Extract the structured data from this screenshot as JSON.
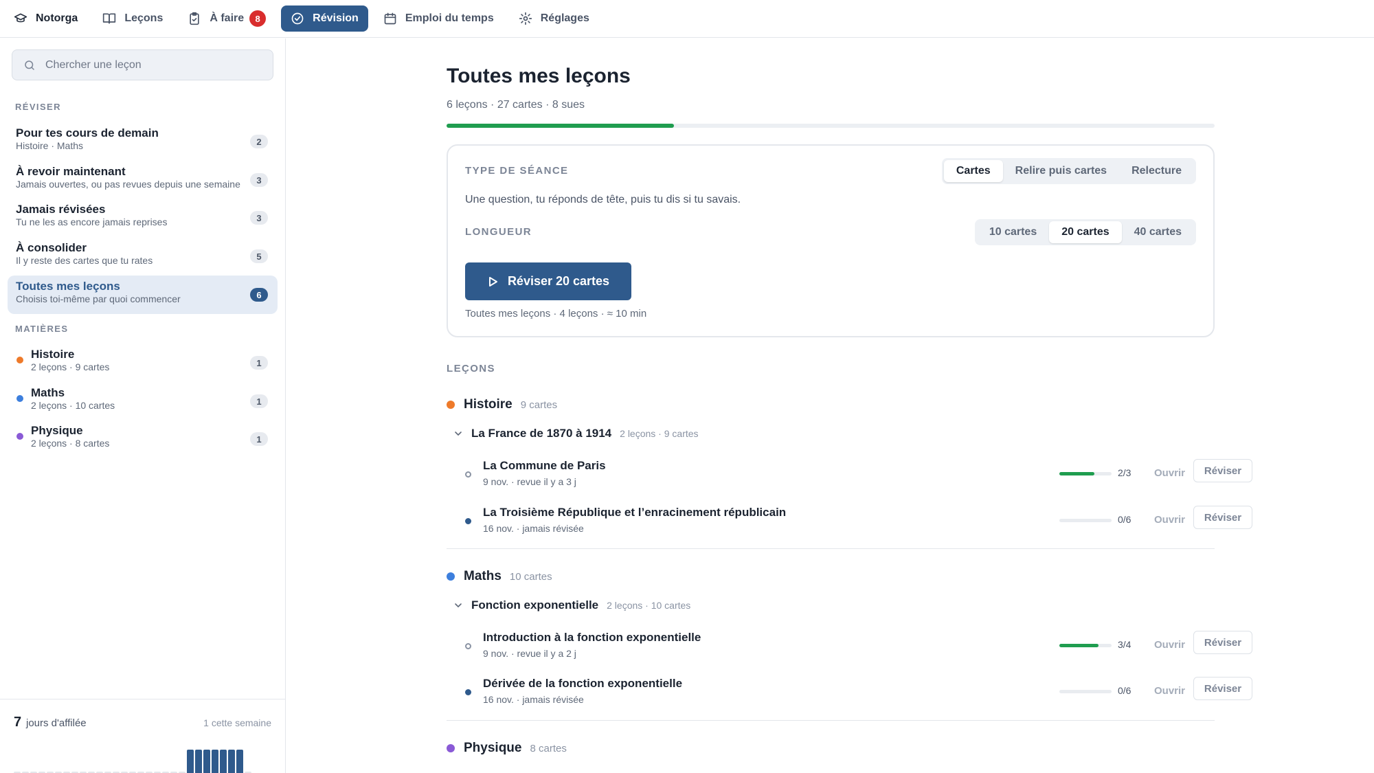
{
  "topbar": {
    "brand": "Notorga",
    "items": [
      {
        "label": "Leçons",
        "icon": "book-icon"
      },
      {
        "label": "À faire",
        "icon": "clipboard-icon",
        "badge": "8"
      },
      {
        "label": "Révision",
        "icon": "check-circle-icon",
        "active": true
      },
      {
        "label": "Emploi du temps",
        "icon": "calendar-icon"
      },
      {
        "label": "Réglages",
        "icon": "gear-icon"
      }
    ]
  },
  "sidebar": {
    "search_placeholder": "Chercher une leçon",
    "review_heading": "RÉVISER",
    "review_items": [
      {
        "title": "Pour tes cours de demain",
        "subtitle": "Histoire · Maths",
        "count": "2"
      },
      {
        "title": "À revoir maintenant",
        "subtitle": "Jamais ouvertes, ou pas revues depuis une semaine",
        "count": "3"
      },
      {
        "title": "Jamais révisées",
        "subtitle": "Tu ne les as encore jamais reprises",
        "count": "3"
      },
      {
        "title": "À consolider",
        "subtitle": "Il y reste des cartes que tu rates",
        "count": "5"
      },
      {
        "title": "Toutes mes leçons",
        "subtitle": "Choisis toi-même par quoi commencer",
        "count": "6",
        "active": true
      }
    ],
    "subjects_heading": "MATIÈRES",
    "subjects": [
      {
        "name": "Histoire",
        "meta": "2 leçons · 9 cartes",
        "count": "1",
        "color": "#ee7a2a"
      },
      {
        "name": "Maths",
        "meta": "2 leçons · 10 cartes",
        "count": "1",
        "color": "#3d7fdd"
      },
      {
        "name": "Physique",
        "meta": "2 leçons · 8 cartes",
        "count": "1",
        "color": "#8a5ad6"
      }
    ],
    "streak": {
      "days": "7",
      "label": "jours d'affilée",
      "week": "1 cette semaine",
      "activity": [
        0,
        0,
        0,
        0,
        0,
        0,
        0,
        0,
        0,
        0,
        0,
        0,
        0,
        0,
        0,
        0,
        0,
        0,
        0,
        0,
        0,
        1,
        1,
        1,
        1,
        1,
        1,
        1,
        0
      ]
    }
  },
  "main": {
    "title": "Toutes mes leçons",
    "meta": "6 leçons · 27 cartes · 8 sues",
    "progress": 0.296,
    "session": {
      "type_label": "TYPE DE SÉANCE",
      "type_options": [
        "Cartes",
        "Relire puis cartes",
        "Relecture"
      ],
      "type_selected": 0,
      "description": "Une question, tu réponds de tête, puis tu dis si tu savais.",
      "length_label": "LONGUEUR",
      "length_options": [
        "10 cartes",
        "20 cartes",
        "40 cartes"
      ],
      "length_selected": 1,
      "start_button": "Réviser 20 cartes",
      "footer": "Toutes mes leçons · 4 leçons · ≈ 10 min"
    },
    "lessons_label": "LEÇONS",
    "subjects": [
      {
        "name": "Histoire",
        "meta": "9 cartes",
        "color": "#ee7a2a",
        "chapter": {
          "name": "La France de 1870 à 1914",
          "meta": "2 leçons · 9 cartes"
        },
        "lessons": [
          {
            "name": "La Commune de Paris",
            "meta": "9 nov. · revue il y a 3 j",
            "score": "2/3",
            "progress": 0.667,
            "state": "open"
          },
          {
            "name": "La Troisième République et l’enracinement républicain",
            "meta": "16 nov. · jamais révisée",
            "score": "0/6",
            "progress": 0,
            "state": "new"
          }
        ]
      },
      {
        "name": "Maths",
        "meta": "10 cartes",
        "color": "#3d7fdd",
        "chapter": {
          "name": "Fonction exponentielle",
          "meta": "2 leçons · 10 cartes"
        },
        "lessons": [
          {
            "name": "Introduction à la fonction exponentielle",
            "meta": "9 nov. · revue il y a 2 j",
            "score": "3/4",
            "progress": 0.75,
            "state": "open"
          },
          {
            "name": "Dérivée de la fonction exponentielle",
            "meta": "16 nov. · jamais révisée",
            "score": "0/6",
            "progress": 0,
            "state": "new"
          }
        ]
      },
      {
        "name": "Physique",
        "meta": "8 cartes",
        "color": "#8a5ad6"
      }
    ],
    "open_label": "Ouvrir",
    "review_label": "Réviser"
  }
}
